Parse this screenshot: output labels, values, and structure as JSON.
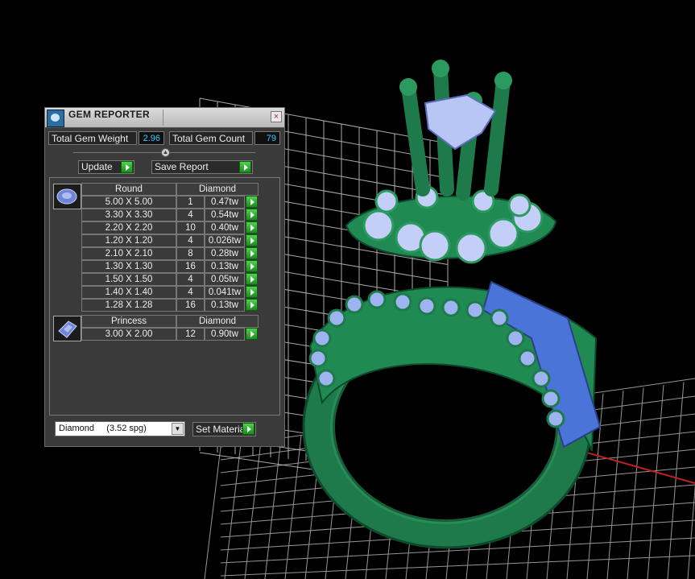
{
  "panel": {
    "title": "GEM REPORTER",
    "close_glyph": "×",
    "total_gem_weight_label": "Total Gem Weight",
    "total_gem_weight_value": "2.96",
    "total_gem_count_label": "Total Gem Count",
    "total_gem_count_value": "79",
    "update_label": "Update",
    "save_report_label": "Save Report",
    "slider_glyph": "▲"
  },
  "gem_groups": [
    {
      "shape": "Round",
      "material": "Diamond",
      "icon": "round-gem-icon",
      "rows": [
        {
          "size": "5.00 X 5.00",
          "count": "1",
          "weight": "0.47tw"
        },
        {
          "size": "3.30 X 3.30",
          "count": "4",
          "weight": "0.54tw"
        },
        {
          "size": "2.20 X 2.20",
          "count": "10",
          "weight": "0.40tw"
        },
        {
          "size": "1.20 X 1.20",
          "count": "4",
          "weight": "0.026tw"
        },
        {
          "size": "2.10 X 2.10",
          "count": "8",
          "weight": "0.28tw"
        },
        {
          "size": "1.30 X 1.30",
          "count": "16",
          "weight": "0.13tw"
        },
        {
          "size": "1.50 X 1.50",
          "count": "4",
          "weight": "0.05tw"
        },
        {
          "size": "1.40 X 1.40",
          "count": "4",
          "weight": "0.041tw"
        },
        {
          "size": "1.28 X 1.28",
          "count": "16",
          "weight": "0.13tw"
        }
      ]
    },
    {
      "shape": "Princess",
      "material": "Diamond",
      "icon": "princess-gem-icon",
      "rows": [
        {
          "size": "3.00 X 2.00",
          "count": "12",
          "weight": "0.90tw"
        }
      ]
    }
  ],
  "material_select": {
    "value": "Diamond     (3.52 spg)",
    "arrow_glyph": "▼"
  },
  "set_material_label": "Set Material",
  "colors": {
    "ring_green": "#1e7a4a",
    "gem_blue": "#9db4f0",
    "grid": "#c9c9c9",
    "value_cyan": "#3fc6ff",
    "go_green": "#2fb52f"
  }
}
